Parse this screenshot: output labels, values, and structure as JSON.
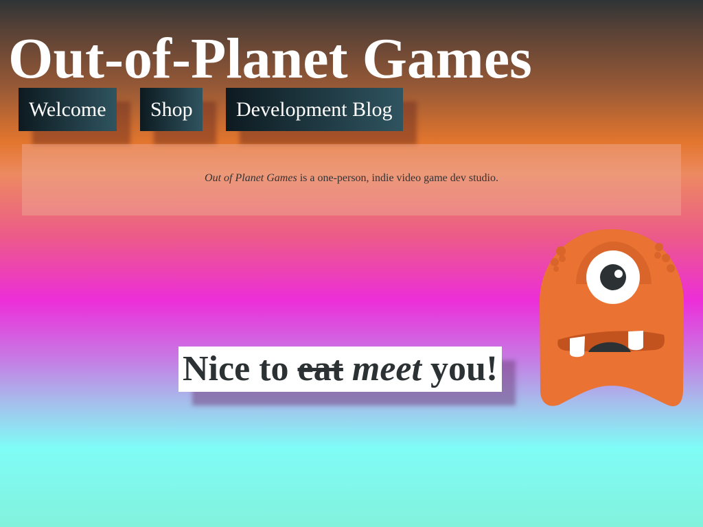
{
  "site": {
    "title": "Out-of-Planet Games"
  },
  "nav": {
    "items": [
      {
        "label": "Welcome"
      },
      {
        "label": "Shop"
      },
      {
        "label": "Development Blog"
      }
    ]
  },
  "intro": {
    "studio_name": "Out of Planet Games",
    "description": " is a one-person, indie video game dev studio."
  },
  "greeting": {
    "part1": "Nice to ",
    "struck": "eat",
    "emphasis": "meet",
    "part2": " you!"
  },
  "mascot": {
    "icon": "one-eyed-orange-monster",
    "color": "#ea7232"
  },
  "colors": {
    "nav_dark": "#0d1a20",
    "nav_light": "#2f5460",
    "heading_text": "#2c3234"
  }
}
